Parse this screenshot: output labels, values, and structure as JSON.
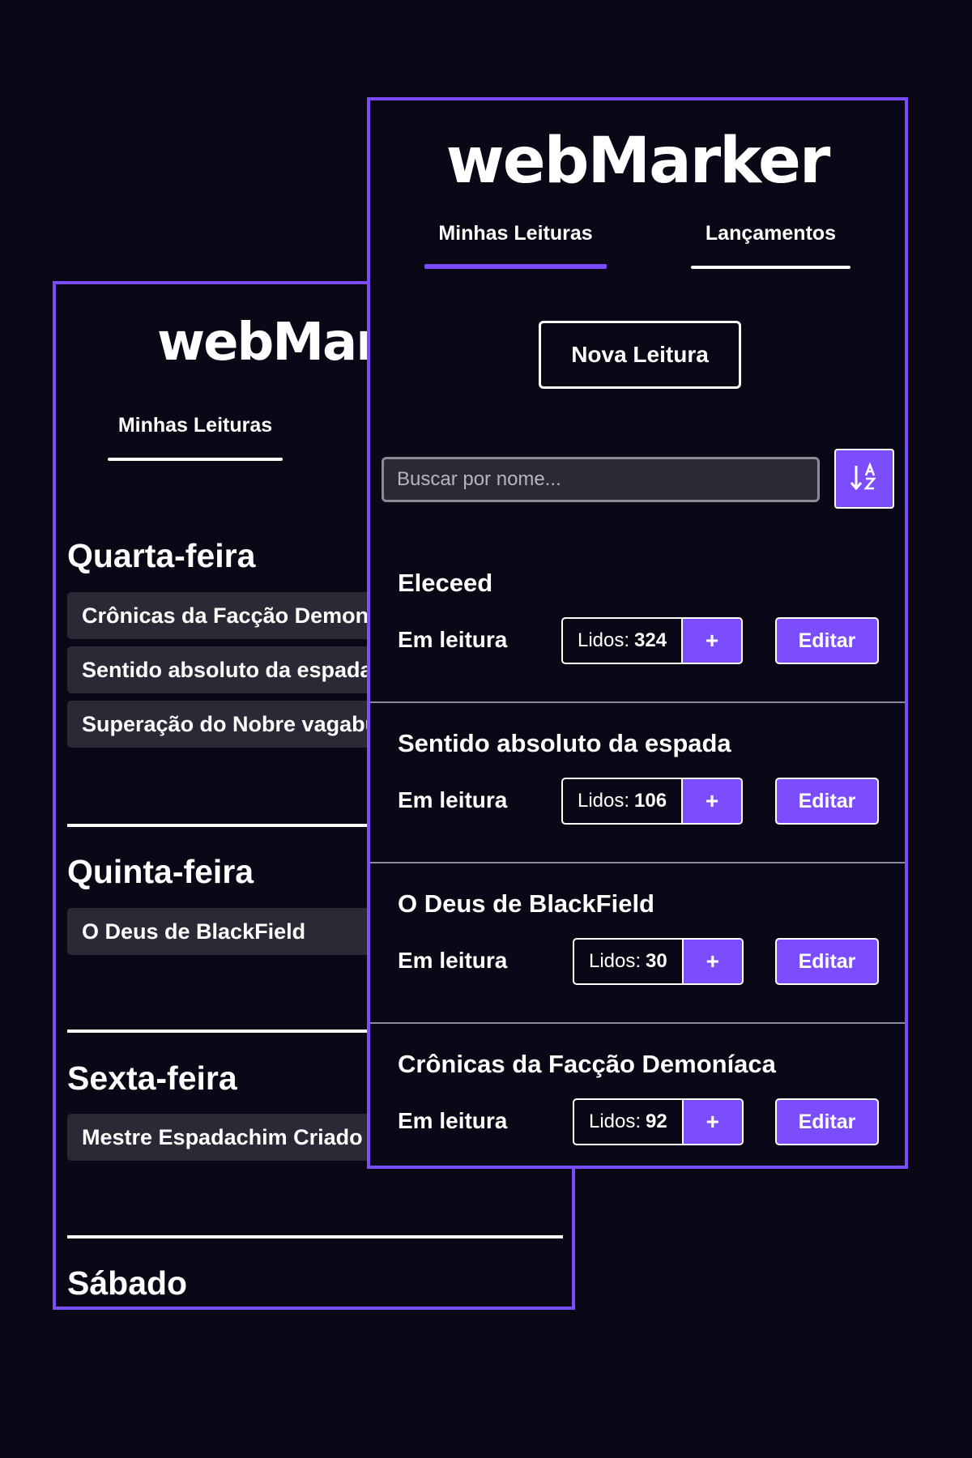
{
  "colors": {
    "background": "#0a0716",
    "accent": "#7c4dff",
    "item_bg": "#2b2935",
    "text": "#ffffff"
  },
  "back_screen": {
    "logo": "webMarker",
    "tabs": [
      {
        "label": "Minhas Leituras",
        "active": false
      }
    ],
    "days": [
      {
        "name": "Quarta-feira",
        "items": [
          "Crônicas da Facção Demoníaca",
          "Sentido absoluto da espada",
          "Superação do Nobre vagabundo"
        ]
      },
      {
        "name": "Quinta-feira",
        "items": [
          "O Deus de BlackField"
        ]
      },
      {
        "name": "Sexta-feira",
        "items": [
          "Mestre Espadachim Criado"
        ]
      },
      {
        "name": "Sábado",
        "items": []
      }
    ]
  },
  "front_screen": {
    "logo": "webMarker",
    "tabs": [
      {
        "label": "Minhas Leituras",
        "active": true
      },
      {
        "label": "Lançamentos",
        "active": false
      }
    ],
    "new_button": "Nova Leitura",
    "search": {
      "placeholder": "Buscar por nome...",
      "value": ""
    },
    "sort_icon": "sort-alpha-icon",
    "readings": [
      {
        "title": "Eleceed",
        "status": "Em leitura",
        "read_label": "Lidos:",
        "read_count": "324",
        "plus": "+",
        "edit": "Editar"
      },
      {
        "title": "Sentido absoluto da espada",
        "status": "Em leitura",
        "read_label": "Lidos:",
        "read_count": "106",
        "plus": "+",
        "edit": "Editar"
      },
      {
        "title": "O Deus de BlackField",
        "status": "Em leitura",
        "read_label": "Lidos:",
        "read_count": "30",
        "plus": "+",
        "edit": "Editar"
      },
      {
        "title": "Crônicas da Facção Demoníaca",
        "status": "Em leitura",
        "read_label": "Lidos:",
        "read_count": "92",
        "plus": "+",
        "edit": "Editar"
      }
    ]
  }
}
